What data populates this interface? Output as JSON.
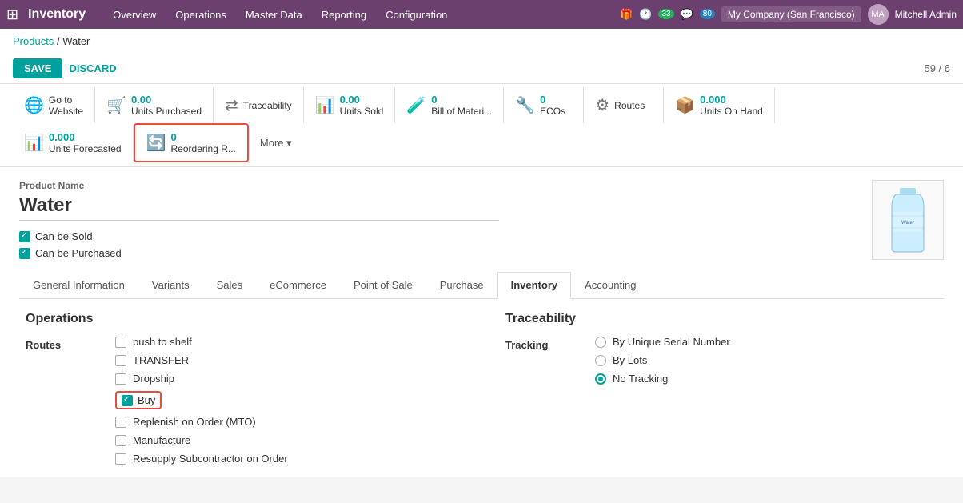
{
  "app": {
    "title": "Inventory",
    "grid_icon": "⊞"
  },
  "topnav": {
    "items": [
      "Overview",
      "Operations",
      "Master Data",
      "Reporting",
      "Configuration"
    ],
    "notifications": {
      "count1": "33",
      "count2": "80"
    },
    "company": "My Company (San Francisco)",
    "user": "Mitchell Admin"
  },
  "breadcrumb": {
    "parent": "Products",
    "separator": "/",
    "current": "Water"
  },
  "toolbar": {
    "save_label": "SAVE",
    "discard_label": "DISCARD",
    "record_nav": "59 / 6"
  },
  "smart_buttons": [
    {
      "id": "go-to-website",
      "icon": "🌐",
      "label": "Go to\nWebsite",
      "value": ""
    },
    {
      "id": "units-purchased",
      "icon": "🛒",
      "value": "0.00",
      "label": "Units Purchased"
    },
    {
      "id": "traceability",
      "icon": "⇄",
      "value": "",
      "label": "Traceability"
    },
    {
      "id": "units-sold",
      "icon": "📊",
      "value": "0.00",
      "label": "Units Sold"
    },
    {
      "id": "bom",
      "icon": "🧪",
      "value": "0",
      "label": "Bill of Materi..."
    },
    {
      "id": "ecos",
      "icon": "🔧",
      "value": "0",
      "label": "ECOs"
    },
    {
      "id": "routes",
      "icon": "⚙",
      "value": "",
      "label": "Routes"
    },
    {
      "id": "units-on-hand",
      "icon": "📦",
      "value": "0.000",
      "label": "Units On Hand"
    }
  ],
  "smart_buttons_row2": [
    {
      "id": "forecasted",
      "icon": "📊",
      "value": "0.000",
      "label": "Units\nForecasted"
    },
    {
      "id": "reordering",
      "icon": "🔄",
      "value": "0",
      "label": "Reordering R...",
      "highlighted": true
    },
    {
      "id": "more",
      "label": "More ▾"
    }
  ],
  "product": {
    "name_label": "Product Name",
    "name": "Water",
    "can_be_sold": "Can be Sold",
    "can_be_purchased": "Can be Purchased"
  },
  "tabs": [
    {
      "id": "general",
      "label": "General Information",
      "active": false
    },
    {
      "id": "variants",
      "label": "Variants",
      "active": false
    },
    {
      "id": "sales",
      "label": "Sales",
      "active": false
    },
    {
      "id": "ecommerce",
      "label": "eCommerce",
      "active": false
    },
    {
      "id": "pos",
      "label": "Point of Sale",
      "active": false
    },
    {
      "id": "purchase",
      "label": "Purchase",
      "active": false
    },
    {
      "id": "inventory",
      "label": "Inventory",
      "active": true
    },
    {
      "id": "accounting",
      "label": "Accounting",
      "active": false
    }
  ],
  "operations": {
    "title": "Operations",
    "routes_label": "Routes",
    "routes": [
      {
        "id": "push-to-shelf",
        "label": "push to shelf",
        "checked": false
      },
      {
        "id": "transfer",
        "label": "TRANSFER",
        "checked": false
      },
      {
        "id": "dropship",
        "label": "Dropship",
        "checked": false
      },
      {
        "id": "buy",
        "label": "Buy",
        "checked": true,
        "highlighted": true
      },
      {
        "id": "replenish-mto",
        "label": "Replenish on Order (MTO)",
        "checked": false
      },
      {
        "id": "manufacture",
        "label": "Manufacture",
        "checked": false
      },
      {
        "id": "resupply",
        "label": "Resupply Subcontractor on Order",
        "checked": false
      }
    ]
  },
  "traceability": {
    "title": "Traceability",
    "tracking_label": "Tracking",
    "options": [
      {
        "id": "serial",
        "label": "By Unique Serial Number",
        "checked": false
      },
      {
        "id": "lots",
        "label": "By Lots",
        "checked": false
      },
      {
        "id": "no-tracking",
        "label": "No Tracking",
        "checked": true
      }
    ]
  }
}
